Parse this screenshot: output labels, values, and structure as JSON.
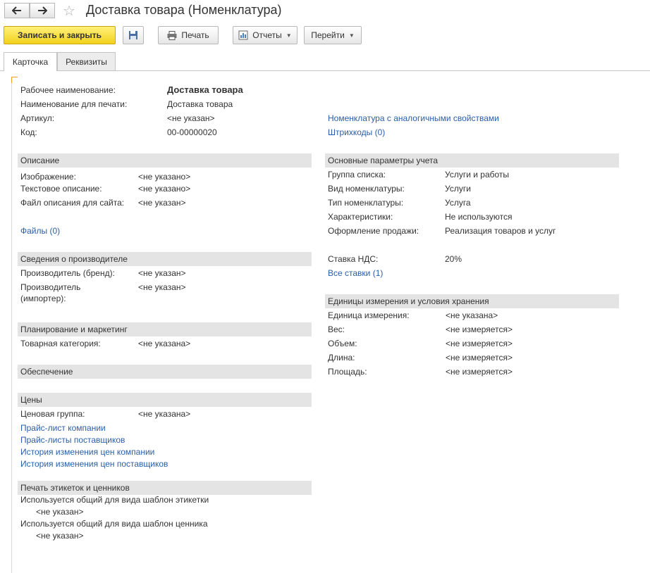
{
  "window": {
    "title": "Доставка товара (Номенклатура)"
  },
  "toolbar": {
    "save_close": "Записать и закрыть",
    "print": "Печать",
    "reports": "Отчеты",
    "goto": "Перейти"
  },
  "tabs": [
    "Карточка",
    "Реквизиты"
  ],
  "header_fields": {
    "working_name_label": "Рабочее наименование:",
    "working_name_value": "Доставка товара",
    "print_name_label": "Наименование для печати:",
    "print_name_value": "Доставка товара",
    "article_label": "Артикул:",
    "article_value": "<не указан>",
    "code_label": "Код:",
    "code_value": "00-00000020"
  },
  "right_links": {
    "similar": "Номенклатура с аналогичными свойствами",
    "barcodes": "Штрихкоды (0)"
  },
  "description": {
    "title": "Описание",
    "image_label": "Изображение:",
    "image_value": "<не указано>",
    "text_label": "Текстовое описание:",
    "text_value": "<не указано>",
    "file_label": "Файл описания для сайта:",
    "file_value": "<не указан>",
    "files_link": "Файлы (0)"
  },
  "manufacturer": {
    "title": "Сведения о производителе",
    "brand_label": "Производитель (бренд):",
    "brand_value": "<не указан>",
    "importer_label_1": "Производитель",
    "importer_label_2": "(импортер):",
    "importer_value": "<не указан>"
  },
  "planning": {
    "title": "Планирование и маркетинг",
    "category_label": "Товарная категория:",
    "category_value": "<не указана>"
  },
  "supply": {
    "title": "Обеспечение"
  },
  "prices": {
    "title": "Цены",
    "group_label": "Ценовая группа:",
    "group_value": "<не указана>",
    "links": [
      "Прайс-лист компании",
      "Прайс-листы поставщиков",
      "История изменения цен компании",
      "История изменения цен поставщиков"
    ]
  },
  "labels_print": {
    "title": "Печать этикеток и ценников",
    "label_template_text": "Используется общий для вида шаблон этикетки",
    "label_template_value": "<не указан>",
    "price_tag_text": "Используется общий для вида шаблон ценника",
    "price_tag_value": "<не указан>"
  },
  "accounting": {
    "title": "Основные параметры учета",
    "rows": [
      {
        "label": "Группа списка:",
        "value": "Услуги и работы"
      },
      {
        "label": "Вид номенклатуры:",
        "value": "Услуги"
      },
      {
        "label": "Тип номенклатуры:",
        "value": "Услуга"
      },
      {
        "label": "Характеристики:",
        "value": "Не используются"
      },
      {
        "label": "Оформление продажи:",
        "value": "Реализация товаров и услуг"
      }
    ],
    "vat_label": "Ставка НДС:",
    "vat_value": "20%",
    "all_rates_link": "Все ставки (1)"
  },
  "units": {
    "title": "Единицы измерения и условия хранения",
    "rows": [
      {
        "label": "Единица измерения:",
        "value": "<не указана>"
      },
      {
        "label": "Вес:",
        "value": "<не измеряется>"
      },
      {
        "label": "Объем:",
        "value": "<не измеряется>"
      },
      {
        "label": "Длина:",
        "value": "<не измеряется>"
      },
      {
        "label": "Площадь:",
        "value": "<не измеряется>"
      }
    ]
  }
}
